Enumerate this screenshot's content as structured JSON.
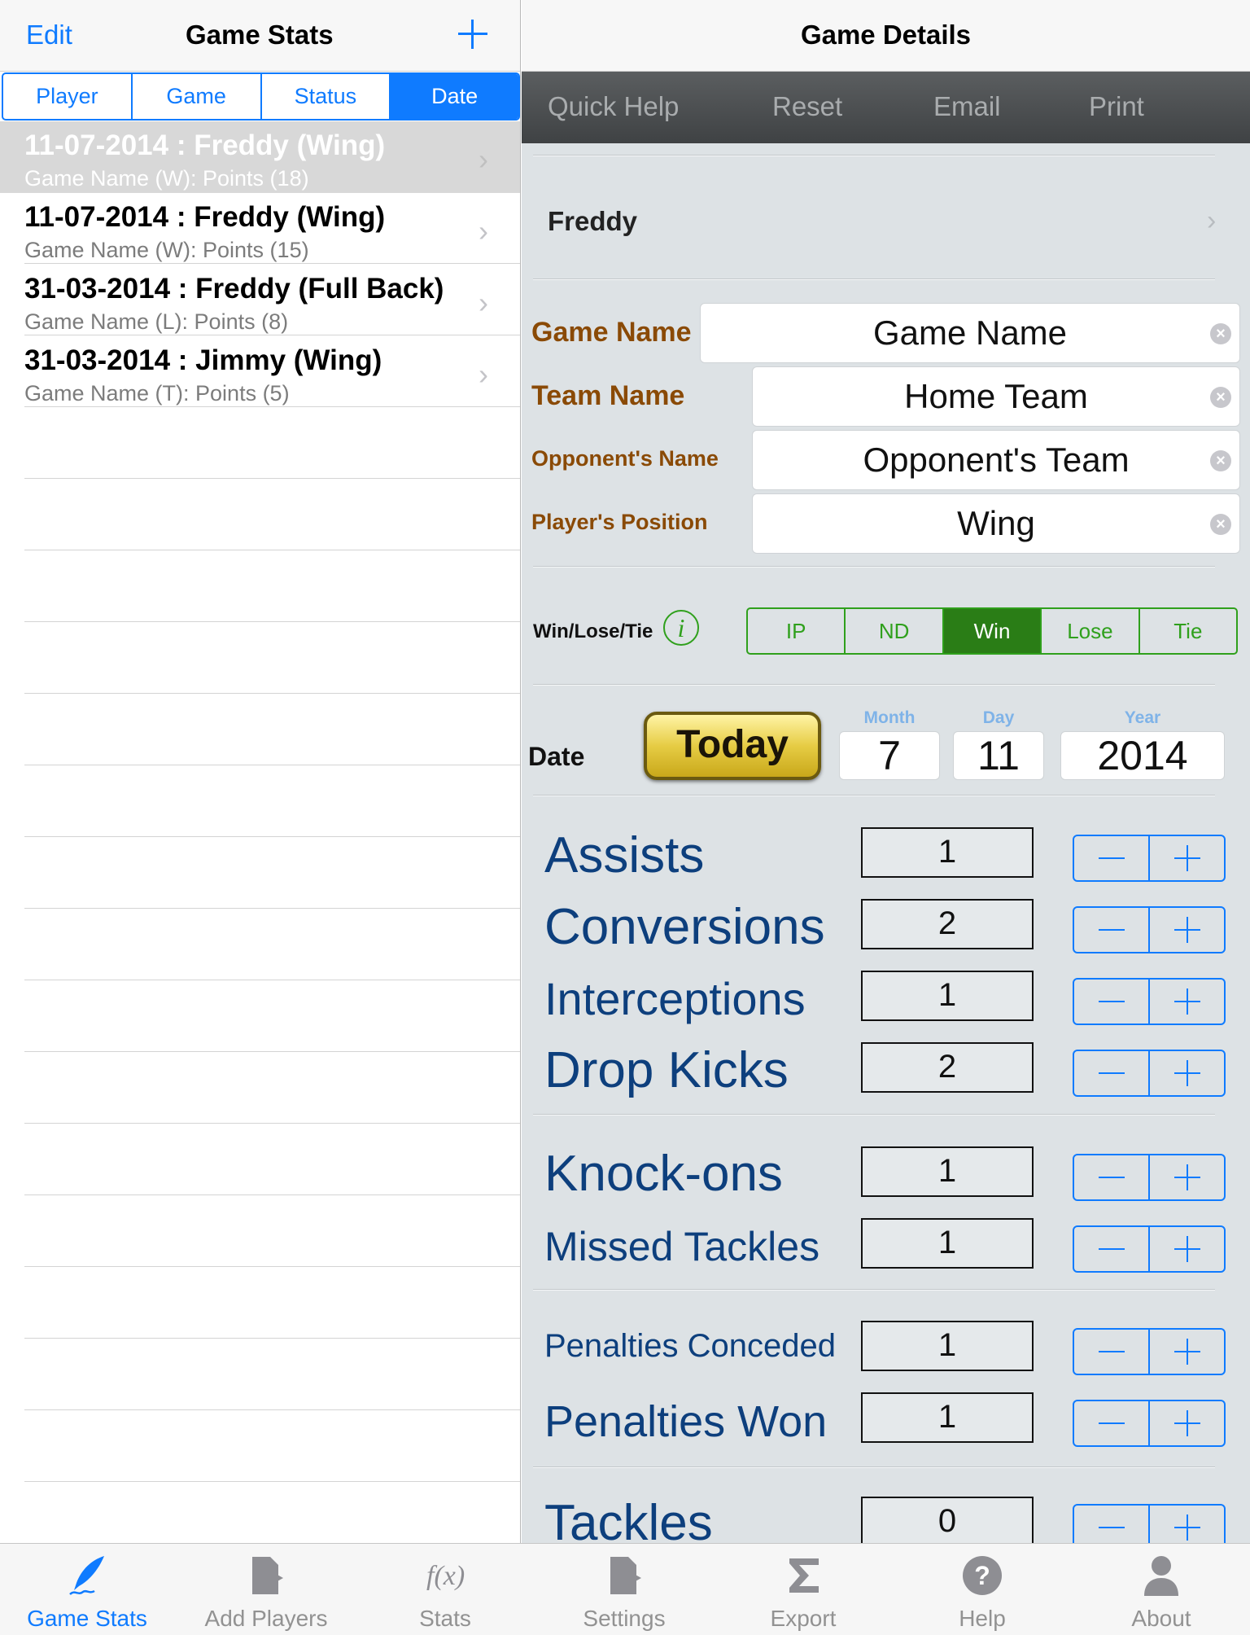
{
  "master": {
    "nav": {
      "edit_label": "Edit",
      "title": "Game Stats"
    },
    "sort_tabs": [
      {
        "label": "Player",
        "selected": false
      },
      {
        "label": "Game",
        "selected": false
      },
      {
        "label": "Status",
        "selected": false
      },
      {
        "label": "Date",
        "selected": true
      }
    ],
    "games": [
      {
        "title": "11-07-2014 : Freddy (Wing)",
        "subtitle": "Game Name (W): Points (18)",
        "selected": true
      },
      {
        "title": "11-07-2014 : Freddy (Wing)",
        "subtitle": "Game Name (W): Points (15)",
        "selected": false
      },
      {
        "title": "31-03-2014 : Freddy (Full Back)",
        "subtitle": "Game Name (L): Points (8)",
        "selected": false
      },
      {
        "title": "31-03-2014 : Jimmy (Wing)",
        "subtitle": "Game Name (T): Points (5)",
        "selected": false
      }
    ]
  },
  "detail": {
    "nav": {
      "title": "Game Details"
    },
    "toolbar": [
      "Quick Help",
      "Reset",
      "Email",
      "Print"
    ],
    "player": "Freddy",
    "fields": [
      {
        "label": "Game Name",
        "value": "Game Name"
      },
      {
        "label": "Team Name",
        "value": "Home Team"
      },
      {
        "label": "Opponent's Name",
        "value": "Opponent's Team"
      },
      {
        "label": "Player's Position",
        "value": "Wing"
      }
    ],
    "result": {
      "label": "Win/Lose/Tie",
      "info_icon": "i",
      "options": [
        "IP",
        "ND",
        "Win",
        "Lose",
        "Tie"
      ],
      "selected": "Win"
    },
    "date": {
      "label": "Date",
      "today_button": "Today",
      "month_caption": "Month",
      "month": "7",
      "day_caption": "Day",
      "day": "11",
      "year_caption": "Year",
      "year": "2014"
    },
    "stats": [
      {
        "label": "Assists",
        "value": "1"
      },
      {
        "label": "Conversions",
        "value": "2"
      },
      {
        "label": "Interceptions",
        "value": "1"
      },
      {
        "label": "Drop Kicks",
        "value": "2"
      },
      {
        "label": "Knock-ons",
        "value": "1"
      },
      {
        "label": "Missed Tackles",
        "value": "1"
      },
      {
        "label": "Penalties Conceded",
        "value": "1"
      },
      {
        "label": "Penalties Won",
        "value": "1"
      },
      {
        "label": "Tackles",
        "value": "0"
      }
    ]
  },
  "tabbar": [
    {
      "label": "Game Stats",
      "icon": "quill-icon",
      "active": true
    },
    {
      "label": "Add Players",
      "icon": "document-arrow-icon",
      "active": false
    },
    {
      "label": "Stats",
      "icon": "function-icon",
      "active": false
    },
    {
      "label": "Settings",
      "icon": "document-arrow-icon",
      "active": false
    },
    {
      "label": "Export",
      "icon": "sigma-icon",
      "active": false
    },
    {
      "label": "Help",
      "icon": "question-icon",
      "active": false
    },
    {
      "label": "About",
      "icon": "person-icon",
      "active": false
    }
  ],
  "colors": {
    "accent_blue": "#0f7bff",
    "label_brown": "#8a4a06",
    "stat_label_navy": "#0d3f7d",
    "result_green": "#2fa01c",
    "detail_background": "#dde2e5",
    "toolbar_dark": "#4b4e50"
  }
}
